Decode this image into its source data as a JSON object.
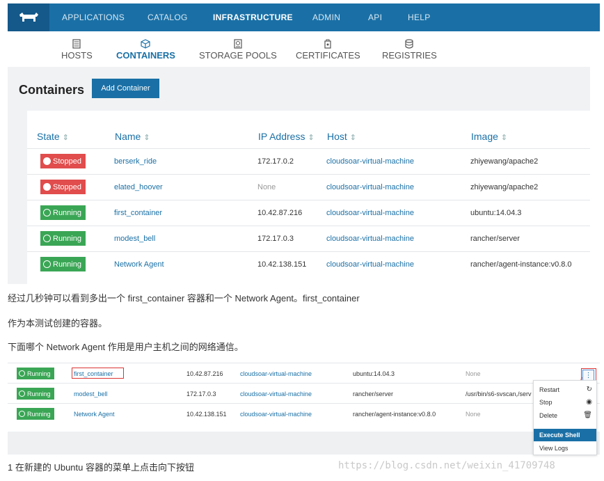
{
  "nav": {
    "items": [
      "APPLICATIONS",
      "CATALOG",
      "INFRASTRUCTURE",
      "ADMIN",
      "API",
      "HELP"
    ],
    "active": "INFRASTRUCTURE"
  },
  "subnav": {
    "items": [
      "HOSTS",
      "CONTAINERS",
      "STORAGE POOLS",
      "CERTIFICATES",
      "REGISTRIES"
    ],
    "active": "CONTAINERS"
  },
  "page": {
    "title": "Containers",
    "add_button": "Add Container"
  },
  "table": {
    "headers": [
      "State",
      "Name",
      "IP Address",
      "Host",
      "Image"
    ],
    "rows": [
      {
        "state": "Stopped",
        "name": "berserk_ride",
        "ip": "172.17.0.2",
        "host": "cloudsoar-virtual-machine",
        "image": "zhiyewang/apache2"
      },
      {
        "state": "Stopped",
        "name": "elated_hoover",
        "ip": "None",
        "host": "cloudsoar-virtual-machine",
        "image": "zhiyewang/apache2"
      },
      {
        "state": "Running",
        "name": "first_container",
        "ip": "10.42.87.216",
        "host": "cloudsoar-virtual-machine",
        "image": "ubuntu:14.04.3"
      },
      {
        "state": "Running",
        "name": "modest_bell",
        "ip": "172.17.0.3",
        "host": "cloudsoar-virtual-machine",
        "image": "rancher/server"
      },
      {
        "state": "Running",
        "name": "Network Agent",
        "ip": "10.42.138.151",
        "host": "cloudsoar-virtual-machine",
        "image": "rancher/agent-instance:v0.8.0"
      }
    ]
  },
  "paragraphs": {
    "p1": "经过几秒钟可以看到多出一个 first_container 容器和一个 Network Agent。first_container",
    "p2": "作为本测试创建的容器。",
    "p3": "下面哪个 Network Agent 作用是用户主机之间的网络通信。"
  },
  "table2": {
    "rows": [
      {
        "state": "Running",
        "name": "first_container",
        "ip": "10.42.87.216",
        "host": "cloudsoar-virtual-machine",
        "image": "ubuntu:14.04.3",
        "command": "None"
      },
      {
        "state": "Running",
        "name": "modest_bell",
        "ip": "172.17.0.3",
        "host": "cloudsoar-virtual-machine",
        "image": "rancher/server",
        "command": "/usr/bin/s6-svscan,/serv"
      },
      {
        "state": "Running",
        "name": "Network Agent",
        "ip": "10.42.138.151",
        "host": "cloudsoar-virtual-machine",
        "image": "rancher/agent-instance:v0.8.0",
        "command": "None"
      }
    ],
    "menu_button": "⋮"
  },
  "dropdown": {
    "items": [
      "Restart",
      "Stop",
      "Delete",
      "Execute Shell",
      "View Logs"
    ],
    "selected": "Execute Shell"
  },
  "caption": "1 在新建的 Ubuntu 容器的菜单上点击向下按钮",
  "watermark": "https://blog.csdn.net/weixin_41709748",
  "colors": {
    "nav_bg": "#1a70a6",
    "stopped": "#e14c4c",
    "running": "#3aa655",
    "link": "#1a70a6",
    "annotation": "#dd3333"
  }
}
